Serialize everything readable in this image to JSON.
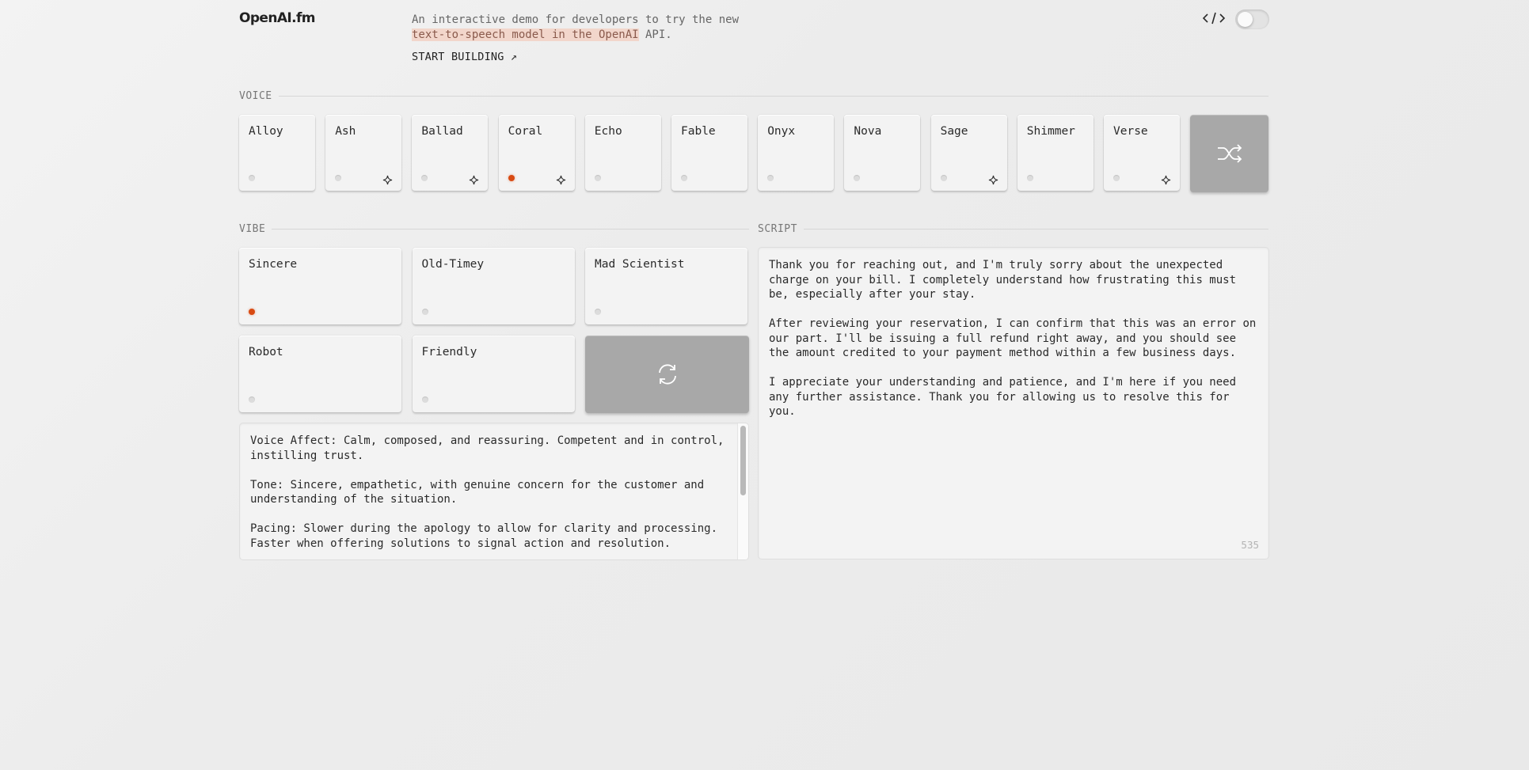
{
  "header": {
    "logo": "OpenAI.fm",
    "desc_part1": "An interactive demo for developers to try the new",
    "desc_highlight": " text-to-speech model in the OpenAI",
    "desc_part2": " API.",
    "start_building": "START BUILDING ↗",
    "code_icon": "code-brackets-icon",
    "toggle_state": "off"
  },
  "voice": {
    "label": "VOICE",
    "items": [
      {
        "name": "Alloy",
        "selected": false,
        "sparkle": false
      },
      {
        "name": "Ash",
        "selected": false,
        "sparkle": true
      },
      {
        "name": "Ballad",
        "selected": false,
        "sparkle": true
      },
      {
        "name": "Coral",
        "selected": true,
        "sparkle": true
      },
      {
        "name": "Echo",
        "selected": false,
        "sparkle": false
      },
      {
        "name": "Fable",
        "selected": false,
        "sparkle": false
      },
      {
        "name": "Onyx",
        "selected": false,
        "sparkle": false
      },
      {
        "name": "Nova",
        "selected": false,
        "sparkle": false
      },
      {
        "name": "Sage",
        "selected": false,
        "sparkle": true
      },
      {
        "name": "Shimmer",
        "selected": false,
        "sparkle": false
      },
      {
        "name": "Verse",
        "selected": false,
        "sparkle": true
      }
    ],
    "shuffle_icon": "shuffle-icon"
  },
  "vibe": {
    "label": "VIBE",
    "items": [
      {
        "name": "Sincere",
        "selected": true
      },
      {
        "name": "Old-Timey",
        "selected": false
      },
      {
        "name": "Mad Scientist",
        "selected": false
      },
      {
        "name": "Robot",
        "selected": false
      },
      {
        "name": "Friendly",
        "selected": false
      }
    ],
    "refresh_icon": "refresh-icon",
    "paragraphs": [
      "Voice Affect: Calm, composed, and reassuring. Competent and in control, instilling trust.",
      "Tone: Sincere, empathetic, with genuine concern for the customer and understanding of the situation.",
      "Pacing: Slower during the apology to allow for clarity and processing. Faster when offering solutions to signal action and resolution."
    ]
  },
  "script": {
    "label": "SCRIPT",
    "paragraphs": [
      "Thank you for reaching out, and I'm truly sorry about the unexpected charge on your bill. I completely understand how frustrating this must be, especially after your stay.",
      "After reviewing your reservation, I can confirm that this was an error on our part. I'll be issuing a full refund right away, and you should see the amount credited to your payment method within a few business days.",
      "I appreciate your understanding and patience, and I'm here if you need any further assistance. Thank you for allowing us to resolve this for you."
    ],
    "char_count": "535"
  },
  "colors": {
    "accent": "#d84a12",
    "highlight": "#f2d6cb",
    "action_button": "#a8a8a8"
  }
}
